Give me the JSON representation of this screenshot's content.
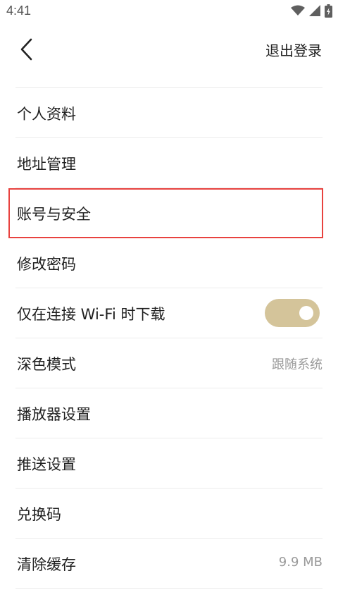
{
  "status_bar": {
    "time": "4:41",
    "icons": [
      "wifi-icon",
      "signal-icon",
      "battery-icon"
    ]
  },
  "header": {
    "back_icon": "chevron-left-icon",
    "logout_label": "退出登录"
  },
  "settings": {
    "items": [
      {
        "label": "个人资料"
      },
      {
        "label": "地址管理"
      },
      {
        "label": "账号与安全"
      },
      {
        "label": "修改密码"
      },
      {
        "label": "仅在连接 Wi-Fi 时下载",
        "toggle_on": true
      },
      {
        "label": "深色模式",
        "value": "跟随系统"
      },
      {
        "label": "播放器设置"
      },
      {
        "label": "推送设置"
      },
      {
        "label": "兑换码"
      },
      {
        "label": "清除缓存",
        "value": "9.9 MB"
      }
    ]
  },
  "colors": {
    "toggle_track": "#d4c49a",
    "highlight_border": "#e8423f",
    "divider": "#ececec",
    "secondary_text": "#9a9a9a"
  }
}
